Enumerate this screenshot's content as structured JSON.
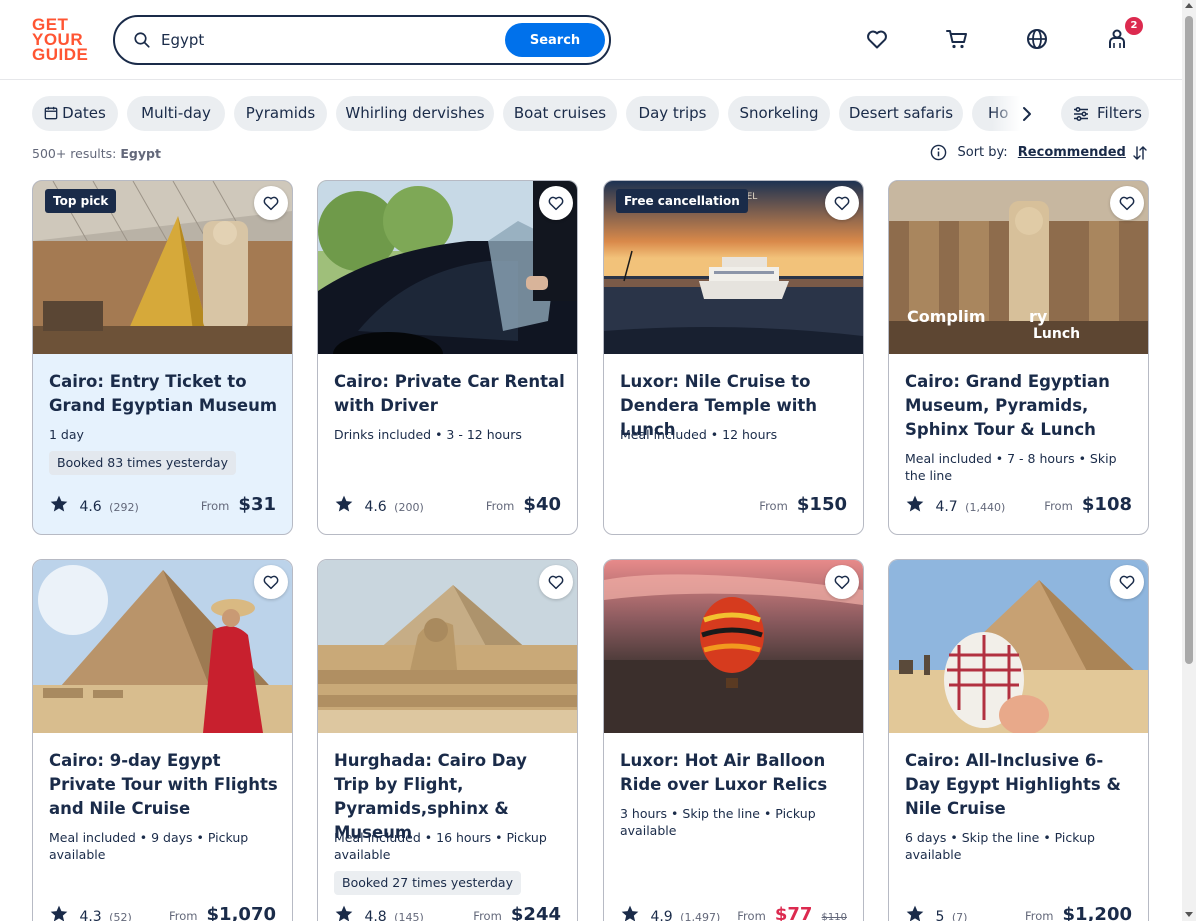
{
  "header": {
    "logo_lines": [
      "GET",
      "YOUR",
      "GUIDE"
    ],
    "search_value": "Egypt",
    "search_button": "Search",
    "cart_badge": "2",
    "colors": {
      "brand": "#ff5533",
      "accent": "#0071eb",
      "badge": "#dc2a4f"
    }
  },
  "chips": [
    "Dates",
    "Multi-day",
    "Pyramids",
    "Whirling dervishes",
    "Boat cruises",
    "Day trips",
    "Snorkeling",
    "Desert safaris",
    "Ho"
  ],
  "filters_label": "Filters",
  "results": {
    "count": "500+ results:",
    "query": "Egypt"
  },
  "sort": {
    "label": "Sort by:",
    "value": "Recommended"
  },
  "cards": [
    {
      "tag": "Top pick",
      "title": "Cairo: Entry Ticket to Grand Egyptian Museum",
      "meta": "1 day",
      "booked": "Booked 83 times yesterday",
      "rating": "4.6",
      "reviews": "(292)",
      "from": "From",
      "price": "$31"
    },
    {
      "title": "Cairo: Private Car Rental with Driver",
      "meta": "Drinks included • 3 - 12 hours",
      "rating": "4.6",
      "reviews": "(200)",
      "from": "From",
      "price": "$40"
    },
    {
      "tag": "Free cancellation",
      "title": "Luxor: Nile Cruise to Dendera Temple with Lunch",
      "meta": "Meal included • 12 hours",
      "from": "From",
      "price": "$150",
      "image_text": "OTEL"
    },
    {
      "title": "Cairo: Grand Egyptian Museum, Pyramids, Sphinx Tour & Lunch",
      "meta": "Meal included • 7 - 8 hours • Skip the line",
      "rating": "4.7",
      "reviews": "(1,440)",
      "from": "From",
      "price": "$108",
      "image_text_1": "Complim",
      "image_text_2": "ry",
      "image_text_3": "Lunch"
    },
    {
      "title": "Cairo: 9-day Egypt Private Tour with Flights and Nile Cruise",
      "meta": "Meal included • 9 days • Pickup available",
      "rating": "4.3",
      "reviews": "(52)",
      "from": "From",
      "price": "$1,070"
    },
    {
      "title": "Hurghada: Cairo Day Trip by Flight, Pyramids,sphinx & Museum",
      "meta": "Meal included • 16 hours • Pickup available",
      "booked": "Booked 27 times yesterday",
      "rating": "4.8",
      "reviews": "(145)",
      "from": "From",
      "price": "$244"
    },
    {
      "title": "Luxor: Hot Air Balloon Ride over Luxor Relics",
      "meta": "3 hours • Skip the line • Pickup available",
      "rating": "4.9",
      "reviews": "(1,497)",
      "from": "From",
      "price": "$77",
      "old_price": "$110"
    },
    {
      "title": "Cairo: All-Inclusive 6-Day Egypt Highlights & Nile Cruise",
      "meta": "6 days • Skip the line • Pickup available",
      "rating": "5",
      "reviews": "(7)",
      "from": "From",
      "price": "$1,200"
    }
  ]
}
